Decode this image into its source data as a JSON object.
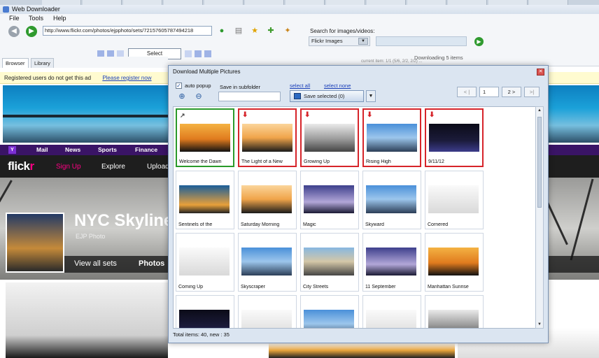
{
  "app": {
    "title": "Web Downloader",
    "menu": [
      "File",
      "Tools",
      "Help"
    ]
  },
  "toolbar": {
    "url": "http://www.flickr.com/photos/ejpphoto/sets/72157605787494218",
    "search_label": "Search for images/videos:",
    "search_source": "Flickr Images",
    "select_label": "Select",
    "downloading": "Downloading 5 items",
    "downloading_detail": "current item: 1/1 (5/6, 2/2, 2/2) ..."
  },
  "tabs": [
    "Browser",
    "Library"
  ],
  "page": {
    "notice": "Registered users do not get this ad",
    "register_link": "Please register now",
    "yahoo_nav": [
      "Mail",
      "News",
      "Sports",
      "Finance"
    ],
    "flickr_logo_a": "flick",
    "flickr_logo_b": "r",
    "flickr_nav": [
      "Sign Up",
      "Explore",
      "Upload"
    ],
    "set_title": "NYC Skyline",
    "set_owner": "EJP Photo",
    "view_all_sets": "View all sets",
    "photos": "Photos"
  },
  "dialog": {
    "title": "Download Multiple Pictures",
    "auto_popup": "auto popup",
    "save_in_subfolder": "Save in subfolder",
    "select_all": "select all",
    "select_none": "select none",
    "save_selected": "Save selected (0)",
    "page_number": "1",
    "next_label": "2 >",
    "status": "Total items: 40, new : 35",
    "items": [
      {
        "caption": "Welcome the Dawn",
        "state": "linked"
      },
      {
        "caption": "The Light of a New",
        "state": "download"
      },
      {
        "caption": "Growing Up",
        "state": "download"
      },
      {
        "caption": "Rising High",
        "state": "download"
      },
      {
        "caption": "9/11/12",
        "state": "download"
      },
      {
        "caption": "Sentinels of the",
        "state": "none"
      },
      {
        "caption": "Saturday Morning",
        "state": "none"
      },
      {
        "caption": "Magic",
        "state": "none"
      },
      {
        "caption": "Skyward",
        "state": "none"
      },
      {
        "caption": "Cornered",
        "state": "none"
      },
      {
        "caption": "Coming Up",
        "state": "none"
      },
      {
        "caption": "Skyscraper",
        "state": "none"
      },
      {
        "caption": "City Streets",
        "state": "none"
      },
      {
        "caption": "11 September",
        "state": "none"
      },
      {
        "caption": "Manhattan Sunrise",
        "state": "none"
      },
      {
        "caption": "",
        "state": "none"
      },
      {
        "caption": "",
        "state": "none"
      },
      {
        "caption": "",
        "state": "none"
      },
      {
        "caption": "",
        "state": "none"
      },
      {
        "caption": "",
        "state": "none"
      }
    ]
  },
  "colors": {
    "accent": "#2f9a2f",
    "selected_green": "#2a9a2a",
    "selected_red": "#d6242a",
    "flickr_pink": "#ff0084",
    "yahoo_purple": "#3a1466"
  }
}
